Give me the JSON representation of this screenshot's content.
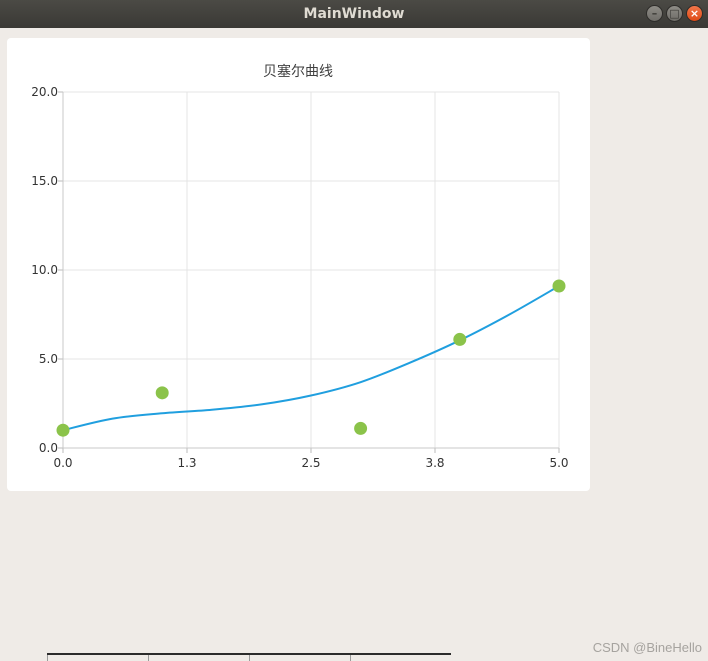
{
  "window": {
    "title": "MainWindow",
    "controls": {
      "minimize": "–",
      "maximize": "□",
      "close": "×"
    }
  },
  "chart_data": {
    "type": "line",
    "title": "贝塞尔曲线",
    "xlim": [
      0,
      5
    ],
    "ylim": [
      0,
      20
    ],
    "x_ticks": [
      "0.0",
      "1.3",
      "2.5",
      "3.8",
      "5.0"
    ],
    "y_ticks": [
      "0.0",
      "5.0",
      "10.0",
      "15.0",
      "20.0"
    ],
    "grid": true,
    "legend": "none",
    "series": [
      {
        "kind": "scatter",
        "color": "#8bc34a",
        "points": [
          [
            0,
            1
          ],
          [
            1,
            3.1
          ],
          [
            3,
            1.1
          ],
          [
            4,
            6.1
          ],
          [
            5,
            9.1
          ]
        ]
      },
      {
        "kind": "smooth-line",
        "color": "#209fdf",
        "points": [
          [
            0,
            1
          ],
          [
            0.5,
            1.65
          ],
          [
            1,
            1.95
          ],
          [
            1.5,
            2.15
          ],
          [
            2,
            2.45
          ],
          [
            2.5,
            2.95
          ],
          [
            3,
            3.7
          ],
          [
            3.5,
            4.8
          ],
          [
            4,
            6.05
          ],
          [
            4.5,
            7.5
          ],
          [
            5,
            9.1
          ]
        ]
      }
    ]
  },
  "watermark": "CSDN @BineHello"
}
